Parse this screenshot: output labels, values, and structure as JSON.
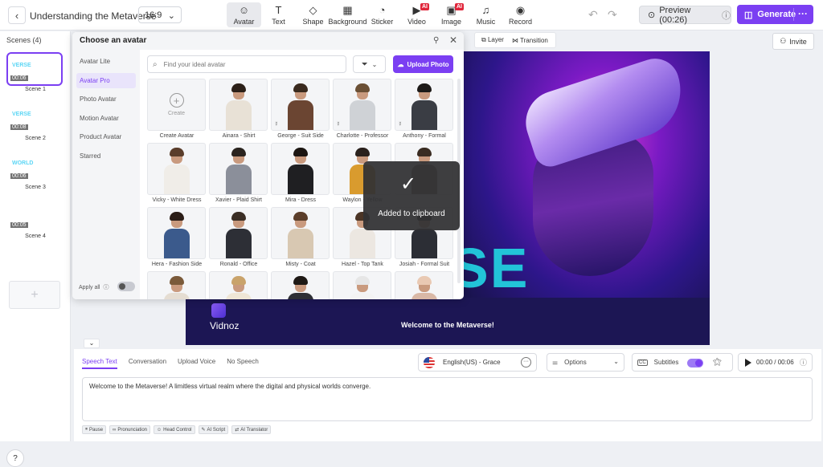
{
  "topbar": {
    "back": "‹",
    "project_title": "Understanding the Metaverse",
    "ratio": "16:9",
    "ratio_chevron": "⌄",
    "tools": [
      {
        "label": "Avatar",
        "icon": "avatar-icon",
        "glyph": "☺"
      },
      {
        "label": "Text",
        "icon": "text-icon",
        "glyph": "T"
      },
      {
        "label": "Shape",
        "icon": "shape-icon",
        "glyph": "◇"
      },
      {
        "label": "Background",
        "icon": "background-icon",
        "glyph": "▦"
      },
      {
        "label": "Sticker",
        "icon": "sticker-icon",
        "glyph": "◔"
      },
      {
        "label": "Video",
        "icon": "video-icon",
        "glyph": "▶",
        "ai": "AI"
      },
      {
        "label": "Image",
        "icon": "image-icon",
        "glyph": "▣",
        "ai": "AI"
      },
      {
        "label": "Music",
        "icon": "music-icon",
        "glyph": "♫"
      },
      {
        "label": "Record",
        "icon": "record-icon",
        "glyph": "◉"
      }
    ],
    "preview_label": "Preview (00:26)",
    "generate_label": "Generate",
    "more": "···"
  },
  "scenes": {
    "title": "Scenes (4)",
    "items": [
      {
        "label": "Scene 1",
        "duration": "00:06",
        "thumb_text": "VERSE"
      },
      {
        "label": "Scene 2",
        "duration": "00:08",
        "thumb_text": "VERSE"
      },
      {
        "label": "Scene 3",
        "duration": "00:06",
        "thumb_text": "WORLD"
      },
      {
        "label": "Scene 4",
        "duration": "00:05",
        "thumb_text": ""
      }
    ],
    "add": "+"
  },
  "canvas": {
    "layer_label": "Layer",
    "transition_label": "Transition",
    "invite_label": "Invite",
    "big_letters": "SE",
    "brand": "Vidnoz",
    "welcome": "Welcome to the Metaverse!"
  },
  "picker": {
    "title": "Choose an avatar",
    "categories": [
      "Avatar Lite",
      "Avatar Pro",
      "Photo Avatar",
      "Motion Avatar",
      "Product Avatar",
      "Starred"
    ],
    "active_category": "Avatar Pro",
    "search_placeholder": "Find your ideal avatar",
    "upload_label": "Upload Photo",
    "apply_all": "Apply all",
    "create_label": "Create",
    "create_avatar_label": "Create Avatar",
    "avatars": [
      {
        "name": "Ainara - Shirt",
        "body": "#e8e1d6",
        "hair": "#2c2018",
        "motion": false
      },
      {
        "name": "George - Suit Side",
        "body": "#6b4532",
        "hair": "#3a2a1e",
        "motion": true
      },
      {
        "name": "Charlotte - Professor",
        "body": "#cfd2d6",
        "hair": "#6b5035",
        "motion": true
      },
      {
        "name": "Anthony - Formal",
        "body": "#3a3d44",
        "hair": "#1d1a18",
        "motion": true
      },
      {
        "name": "Vicky - White Dress",
        "body": "#f0ede8",
        "hair": "#5a3d2b",
        "motion": false
      },
      {
        "name": "Xavier - Plaid Shirt",
        "body": "#8b8f9a",
        "hair": "#2a241f",
        "motion": false
      },
      {
        "name": "Mira - Dress",
        "body": "#1f1f22",
        "hair": "#1c1612",
        "motion": false
      },
      {
        "name": "Waylon - Yellow",
        "body": "#d99b2e",
        "hair": "#2a211c",
        "motion": false
      },
      {
        "name": "",
        "body": "#7b6a5a",
        "hair": "#3a2c22",
        "motion": false
      },
      {
        "name": "Hera - Fashion Side",
        "body": "#3b5a8c",
        "hair": "#2b1d17",
        "motion": false
      },
      {
        "name": "Ronald - Office",
        "body": "#2d2f36",
        "hair": "#3b2e25",
        "motion": false
      },
      {
        "name": "Misty - Coat",
        "body": "#d8c8b2",
        "hair": "#5b3e2a",
        "motion": false
      },
      {
        "name": "Hazel - Top Tank",
        "body": "#ece7e1",
        "hair": "#4b3526",
        "motion": false
      },
      {
        "name": "Josiah - Formal Suit",
        "body": "#2c2e35",
        "hair": "#1b1814",
        "motion": false
      },
      {
        "name": "",
        "body": "#e5ddd2",
        "hair": "#7a5a3a",
        "motion": false
      },
      {
        "name": "",
        "body": "#efe6d6",
        "hair": "#c9a36b",
        "motion": false
      },
      {
        "name": "",
        "body": "#2e2f35",
        "hair": "#1e1915",
        "motion": false
      },
      {
        "name": "",
        "body": "#f3f3f3",
        "hair": "#e6e6e6",
        "motion": false
      },
      {
        "name": "",
        "body": "#d9b8a6",
        "hair": "#e9c9b3",
        "motion": false
      }
    ]
  },
  "toast": {
    "message": "Added to clipboard",
    "check": "✓"
  },
  "bottom": {
    "tabs": [
      "Speech Text",
      "Conversation",
      "Upload Voice",
      "No Speech"
    ],
    "active_tab": "Speech Text",
    "voice": "English(US) - Grace",
    "options_label": "Options",
    "subtitles_label": "Subtitles",
    "time": "00:00 / 00:06",
    "speech_text": "Welcome to the Metaverse! A limitless virtual realm where the digital and physical worlds converge.",
    "chips": [
      "Pause",
      "Pronunciation",
      "Head Control",
      "AI Script",
      "AI Translator"
    ]
  },
  "colors": {
    "accent": "#7b3ff2",
    "stage_bg": "#1b1450",
    "cyan_text": "#22c4d8"
  }
}
